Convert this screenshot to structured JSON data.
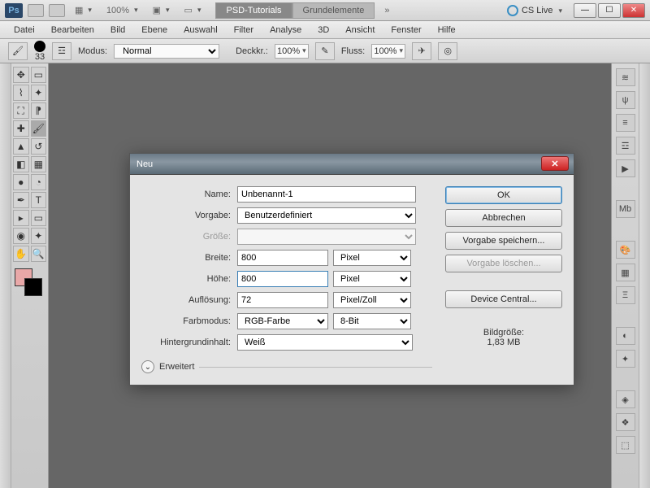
{
  "appbar": {
    "zoom": "100%",
    "doc_tab_active": "PSD-Tutorials",
    "doc_tab_other": "Grundelemente",
    "cslive": "CS Live"
  },
  "menu": [
    "Datei",
    "Bearbeiten",
    "Bild",
    "Ebene",
    "Auswahl",
    "Filter",
    "Analyse",
    "3D",
    "Ansicht",
    "Fenster",
    "Hilfe"
  ],
  "optbar": {
    "brush_size": "33",
    "mode_label": "Modus:",
    "mode_value": "Normal",
    "opacity_label": "Deckkr.:",
    "opacity_value": "100%",
    "flow_label": "Fluss:",
    "flow_value": "100%"
  },
  "dialog": {
    "title": "Neu",
    "labels": {
      "name": "Name:",
      "preset": "Vorgabe:",
      "size": "Größe:",
      "width": "Breite:",
      "height": "Höhe:",
      "resolution": "Auflösung:",
      "colormode": "Farbmodus:",
      "background": "Hintergrundinhalt:",
      "advanced": "Erweitert"
    },
    "values": {
      "name": "Unbenannt-1",
      "preset": "Benutzerdefiniert",
      "size": "",
      "width": "800",
      "width_unit": "Pixel",
      "height": "800",
      "height_unit": "Pixel",
      "resolution": "72",
      "resolution_unit": "Pixel/Zoll",
      "colormode": "RGB-Farbe",
      "colordepth": "8-Bit",
      "background": "Weiß"
    },
    "buttons": {
      "ok": "OK",
      "cancel": "Abbrechen",
      "save_preset": "Vorgabe speichern...",
      "delete_preset": "Vorgabe löschen...",
      "device_central": "Device Central..."
    },
    "imgsize_label": "Bildgröße:",
    "imgsize_value": "1,83 MB"
  }
}
